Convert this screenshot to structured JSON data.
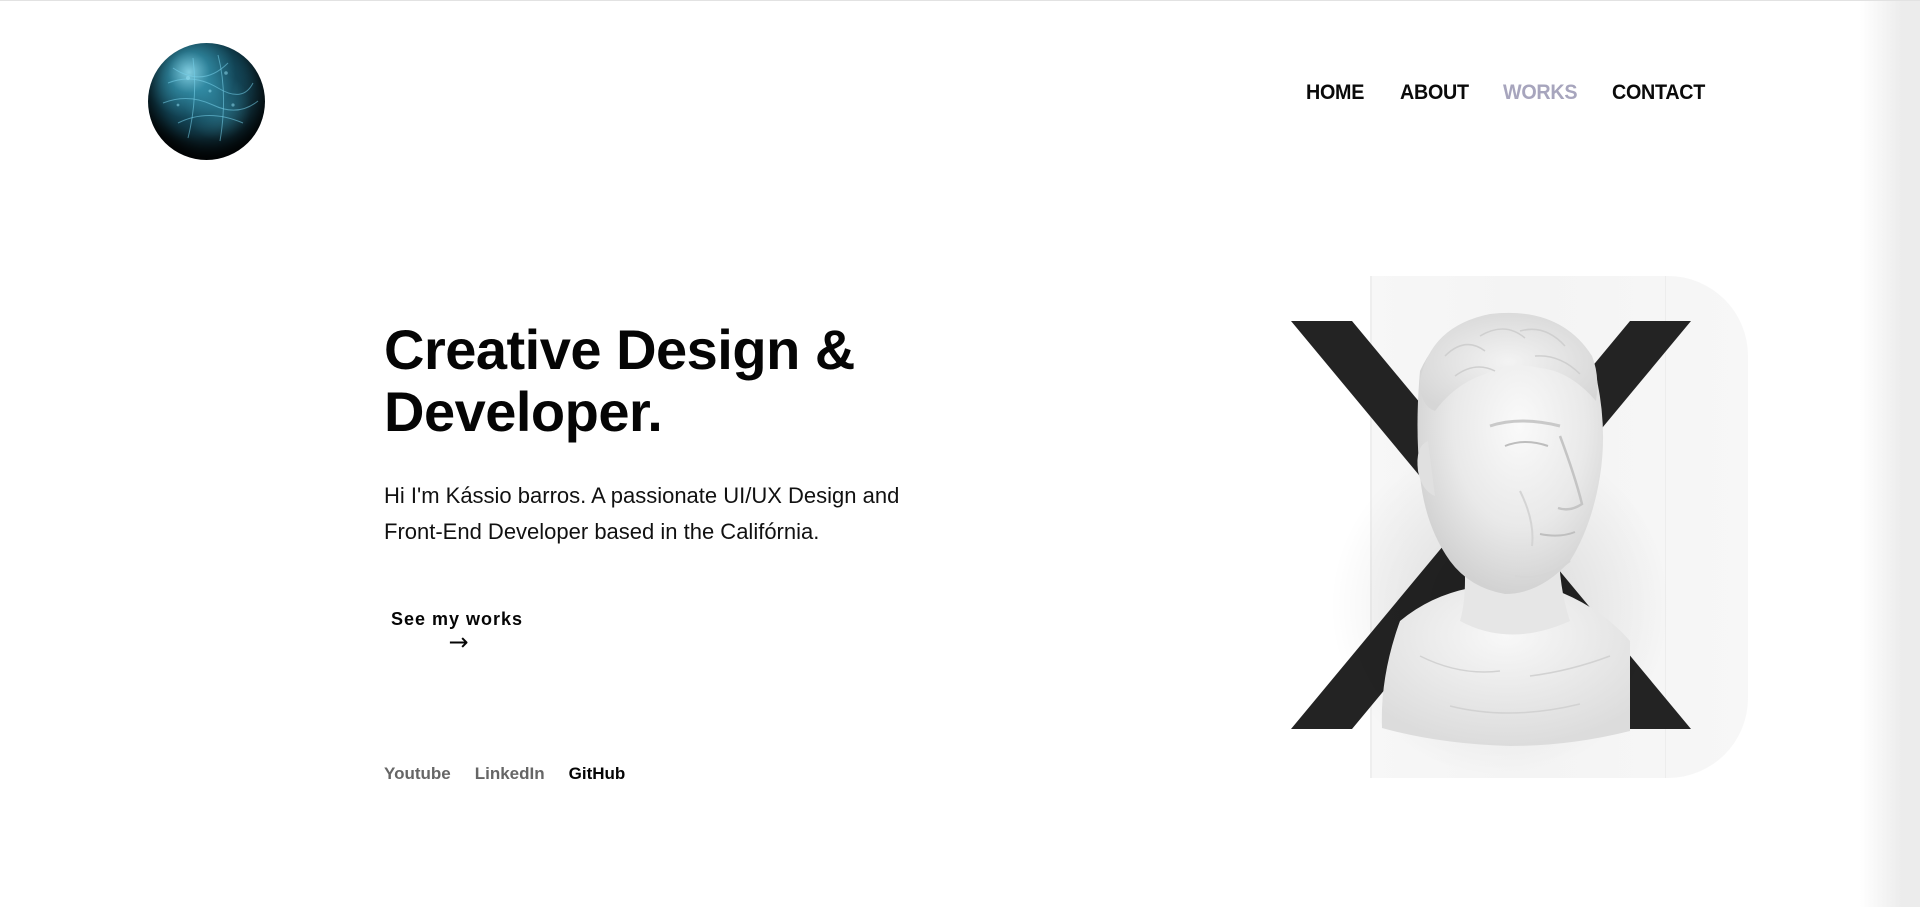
{
  "nav": {
    "items": [
      {
        "label": "HOME",
        "active": false
      },
      {
        "label": "ABOUT",
        "active": false
      },
      {
        "label": "WORKS",
        "active": true
      },
      {
        "label": "CONTACT",
        "active": false
      }
    ]
  },
  "logo": {
    "icon": "planet-globe-icon"
  },
  "hero": {
    "title_line1": "Creative Design &",
    "title_line2": "Developer.",
    "desc_line1": "Hi I'm Kássio barros. A passionate UI/UX Design and",
    "desc_line2": "Front-End Developer based in the Califórnia.",
    "cta_label": "See my works",
    "cta_arrow": "→"
  },
  "socials": [
    {
      "label": "Youtube",
      "active": false
    },
    {
      "label": "LinkedIn",
      "active": false
    },
    {
      "label": "GitHub",
      "active": true
    }
  ],
  "art": {
    "icon": "bust-statue-x-illustration"
  },
  "colors": {
    "text": "#050505",
    "nav_active": "#a7a5bd",
    "social_muted": "#666666",
    "x_mark": "#232323"
  }
}
